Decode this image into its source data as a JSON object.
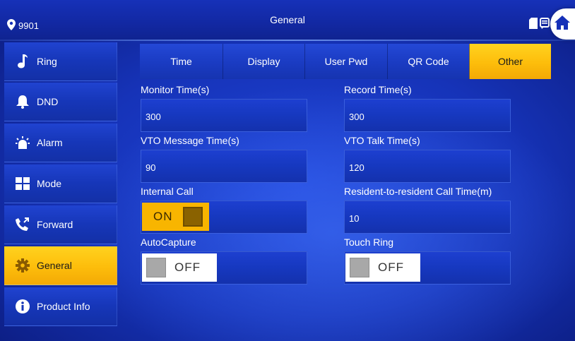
{
  "header": {
    "device_id": "9901",
    "title": "General",
    "icons": [
      "location-pin-icon",
      "sd-card-icon",
      "message-icon",
      "home-icon"
    ]
  },
  "sidebar": {
    "items": [
      {
        "label": "Ring",
        "icon": "music-note-icon"
      },
      {
        "label": "DND",
        "icon": "bell-icon"
      },
      {
        "label": "Alarm",
        "icon": "siren-icon"
      },
      {
        "label": "Mode",
        "icon": "mode-grid-icon"
      },
      {
        "label": "Forward",
        "icon": "call-forward-icon"
      },
      {
        "label": "General",
        "icon": "gear-icon",
        "active": true
      },
      {
        "label": "Product Info",
        "icon": "info-icon"
      }
    ]
  },
  "tabs": [
    {
      "label": "Time"
    },
    {
      "label": "Display"
    },
    {
      "label": "User Pwd"
    },
    {
      "label": "QR Code"
    },
    {
      "label": "Other",
      "active": true
    }
  ],
  "settings": {
    "monitor_time": {
      "label": "Monitor Time(s)",
      "value": "300"
    },
    "record_time": {
      "label": "Record Time(s)",
      "value": "300"
    },
    "vto_message_time": {
      "label": "VTO Message Time(s)",
      "value": "90"
    },
    "vto_talk_time": {
      "label": "VTO Talk Time(s)",
      "value": "120"
    },
    "internal_call": {
      "label": "Internal Call",
      "state": "ON"
    },
    "resident_call_time": {
      "label": "Resident-to-resident Call Time(m)",
      "value": "10"
    },
    "auto_capture": {
      "label": "AutoCapture",
      "state": "OFF"
    },
    "touch_ring": {
      "label": "Touch Ring",
      "state": "OFF"
    }
  },
  "colors": {
    "accent_yellow": "#fdbd0b",
    "background_blue": "#1633b8",
    "toggle_on": "#f8b500",
    "toggle_off": "#ffffff"
  }
}
